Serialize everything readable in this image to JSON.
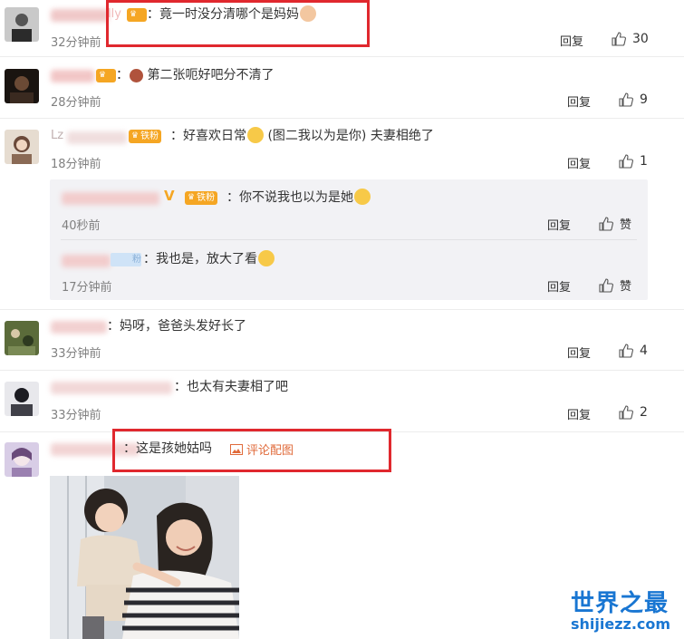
{
  "colors": {
    "accent": "#e06a3a",
    "badge": "#f5a623",
    "watermark": "#1976d2",
    "highlight": "#e0282e"
  },
  "comments": [
    {
      "name_tail": "lly",
      "text": "竟一时没分清哪个是妈妈",
      "time": "32分钟前",
      "reply": "回复",
      "likes": "30"
    },
    {
      "text": "第二张呃好吧分不清了",
      "time": "28分钟前",
      "reply": "回复",
      "likes": "9"
    },
    {
      "name_head": "Lz",
      "badge": "铁粉",
      "text": "好喜欢日常",
      "text2": "(图二我以为是你) 夫妻相绝了",
      "time": "18分钟前",
      "reply": "回复",
      "likes": "1",
      "replies": [
        {
          "badge": "铁粉",
          "text": "你不说我也以为是她",
          "time": "40秒前",
          "reply": "回复",
          "like_label": "赞"
        },
        {
          "badge": "粉",
          "text": "我也是，放大了看",
          "time": "17分钟前",
          "reply": "回复",
          "like_label": "赞"
        }
      ]
    },
    {
      "text": "妈呀，爸爸头发好长了",
      "time": "33分钟前",
      "reply": "回复",
      "likes": "4"
    },
    {
      "text": "也太有夫妻相了吧",
      "time": "33分钟前",
      "reply": "回复",
      "likes": "2"
    },
    {
      "text": "这是孩她姑吗",
      "pic_link": "评论配图"
    }
  ],
  "watermark": {
    "title": "世界之最",
    "site": "shijiezz.com"
  },
  "icons": [
    "thumbs-up-icon",
    "image-icon",
    "emoji-icon",
    "crown-icon"
  ]
}
